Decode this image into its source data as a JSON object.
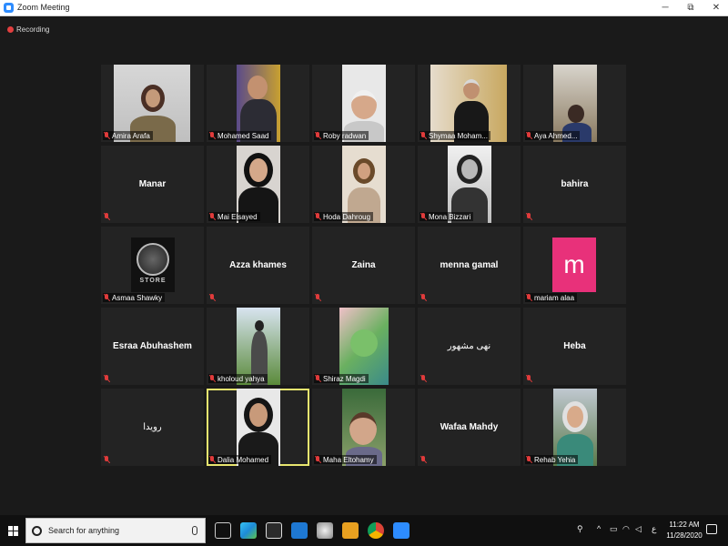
{
  "window": {
    "title": "Zoom Meeting",
    "minimize_glyph": "─",
    "maximize_glyph": "⧉",
    "close_glyph": "✕"
  },
  "recording": {
    "label": "Recording"
  },
  "participants": [
    {
      "name": "Amira Arafa",
      "muted": true,
      "video": true
    },
    {
      "name": "Mohamed Saad",
      "muted": true,
      "video": true
    },
    {
      "name": "Roby radwan",
      "muted": true,
      "video": true
    },
    {
      "name": "Shymaa Moham...",
      "muted": true,
      "video": true
    },
    {
      "name": "Aya Ahmed...",
      "muted": true,
      "video": true
    },
    {
      "name": "Manar",
      "muted": true,
      "video": false
    },
    {
      "name": "Mai Elsayed",
      "muted": true,
      "video": true
    },
    {
      "name": "Hoda Dahroug",
      "muted": true,
      "video": true
    },
    {
      "name": "Mona Bizzari",
      "muted": true,
      "video": true
    },
    {
      "name": "bahira",
      "muted": true,
      "video": false
    },
    {
      "name": "Asmaa Shawky",
      "muted": true,
      "video": true,
      "logo_text": "STORE"
    },
    {
      "name": "Azza khames",
      "muted": true,
      "video": false
    },
    {
      "name": "Zaina",
      "muted": true,
      "video": false
    },
    {
      "name": "menna gamal",
      "muted": true,
      "video": false
    },
    {
      "name": "mariam alaa",
      "muted": true,
      "video": false,
      "avatar_letter": "m"
    },
    {
      "name": "Esraa Abuhashem",
      "muted": true,
      "video": false
    },
    {
      "name": "kholoud yahya",
      "muted": true,
      "video": true
    },
    {
      "name": "Shiraz Magdi",
      "muted": true,
      "video": true
    },
    {
      "name": "نهى مشهور",
      "muted": true,
      "video": false
    },
    {
      "name": "Heba",
      "muted": true,
      "video": false
    },
    {
      "name": "رويدا",
      "muted": true,
      "video": false
    },
    {
      "name": "Dalia Mohamed",
      "muted": true,
      "video": true,
      "active_speaker": true
    },
    {
      "name": "Maha Eltohamy",
      "muted": true,
      "video": true
    },
    {
      "name": "Wafaa Mahdy",
      "muted": true,
      "video": false
    },
    {
      "name": "Rehab Yehia",
      "muted": true,
      "video": true
    }
  ],
  "taskbar": {
    "search_placeholder": "Search for anything",
    "clock_time": "11:22 AM",
    "clock_date": "11/28/2020",
    "lang": "ع"
  },
  "colors": {
    "background": "#1a1a1a",
    "tile": "#232323",
    "active_speaker_border": "#e8e56f",
    "mute_red": "#e03b3b",
    "avatar_pink": "#e8317a",
    "zoom_blue": "#2d8cff"
  }
}
